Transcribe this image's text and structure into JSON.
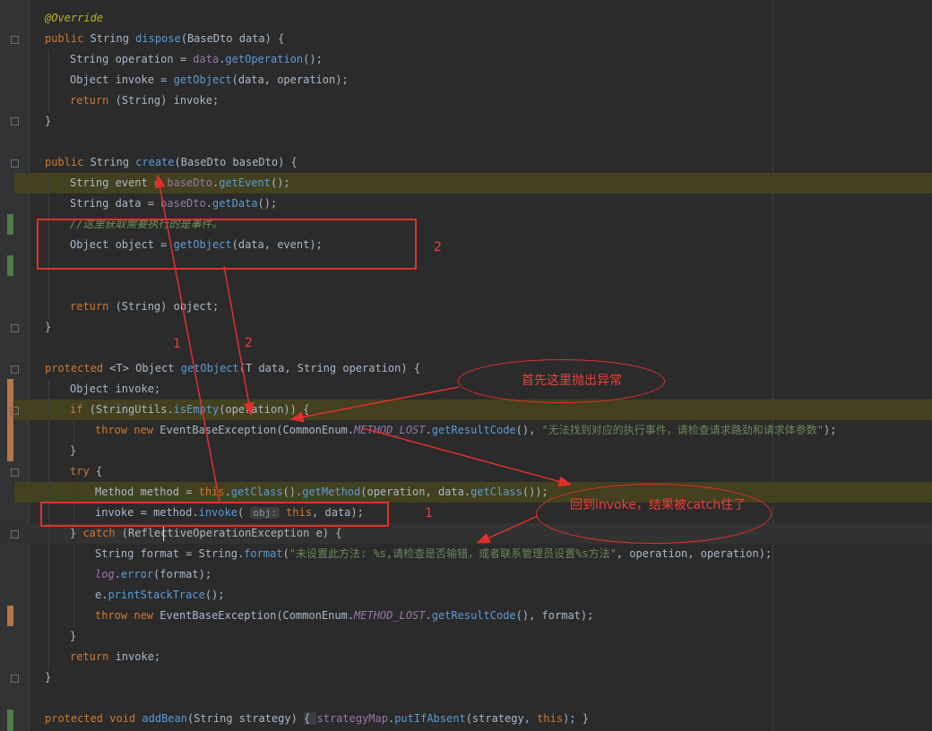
{
  "annotations": {
    "note_throw": "首先这里抛出异常",
    "note_catch": "回到invoke，结果被catch住了",
    "num_1": "1",
    "num_2": "2"
  },
  "code": {
    "override": "@Override",
    "l2_public": "public",
    "l2_string": " String ",
    "l2_fn": "dispose",
    "l2_rest": "(BaseDto data) {",
    "l3_a": "String operation = ",
    "l3_field": "data",
    "l3_dot": ".",
    "l3_fn": "getOperation",
    "l3_end": "();",
    "l4_a": "Object invoke = ",
    "l4_fn": "getObject",
    "l4_end": "(data, operation);",
    "l5_kw": "return",
    "l5_rest": " (String) invoke;",
    "brace_close": "}",
    "l7_public": "public",
    "l7_string": " String ",
    "l7_fn": "create",
    "l7_rest": "(BaseDto baseDto) {",
    "l8_a": "String event = ",
    "l8_field": "baseDto",
    "l8_dot": ".",
    "l8_fn": "getEvent",
    "l8_end": "();",
    "l9_a": "String data = ",
    "l9_field": "baseDto",
    "l9_dot": ".",
    "l9_fn": "getData",
    "l9_end": "();",
    "l10_comment": "//这里获取需要执行的是事件。",
    "l11_a": "Object object = ",
    "l11_fn": "getObject",
    "l11_end": "(data, event);",
    "l12_kw": "return",
    "l12_rest": " (String) object;",
    "l14_kw": "protected",
    "l14_a": " <T> Object ",
    "l14_fn": "getObject",
    "l14_rest": "(T data, String operation) {",
    "l15": "Object invoke;",
    "l16_kw": "if",
    "l16_a": " (StringUtils.",
    "l16_fn": "isEmpty",
    "l16_rest": "(operation)) {",
    "l17_kw1": "throw",
    "l17_sp": " ",
    "l17_kw2": "new",
    "l17_a": " EventBaseException(CommonEnum.",
    "l17_field": "METHOD_LOST",
    "l17_dot": ".",
    "l17_fn": "getResultCode",
    "l17_b": "(), ",
    "l17_str": "\"无法找到对应的执行事件，请检查请求路劲和请求体参数\"",
    "l17_end": ");",
    "l19_kw": "try",
    "l19_rest": " {",
    "l20_a": "Method method = ",
    "l20_this": "this",
    "l20_dot": ".",
    "l20_fn1": "getClass",
    "l20_b": "().",
    "l20_fn2": "getMethod",
    "l20_c": "(operation, data.",
    "l20_fn3": "getClass",
    "l20_end": "());",
    "l21_a": "invoke = method.",
    "l21_fn": "invoke",
    "l21_b": "( ",
    "l21_hint": "obj:",
    "l21_sp": " ",
    "l21_this": "this",
    "l21_end": ", data);",
    "l22_a": "} ",
    "l22_kw": "catch",
    "l22_rest": " (ReflectiveOperationException e) {",
    "l23_a": "String format = String.",
    "l23_fn": "format",
    "l23_b": "(",
    "l23_str": "\"未设置此方法: %s,请检查是否输错，或者联系管理员设置%s方法\"",
    "l23_end": ", operation, operation);",
    "l24_field": "log",
    "l24_dot": ".",
    "l24_fn": "error",
    "l24_end": "(format);",
    "l25_a": "e.",
    "l25_fn": "printStackTrace",
    "l25_end": "();",
    "l26_kw1": "throw",
    "l26_sp": " ",
    "l26_kw2": "new",
    "l26_a": " EventBaseException(CommonEnum.",
    "l26_field": "METHOD_LOST",
    "l26_dot": ".",
    "l26_fn": "getResultCode",
    "l26_end": "(), format);",
    "l28_kw": "return",
    "l28_rest": " invoke;",
    "l30_kw1": "protected",
    "l30_sp": " ",
    "l30_kw2": "void",
    "l30_sp2": " ",
    "l30_fn": "addBean",
    "l30_a": "(String strategy) ",
    "l30_b": "{ ",
    "l30_field": "strategyMap",
    "l30_dot": ".",
    "l30_fn2": "putIfAbsent",
    "l30_c": "(strategy, ",
    "l30_this": "this",
    "l30_end": "); }"
  }
}
